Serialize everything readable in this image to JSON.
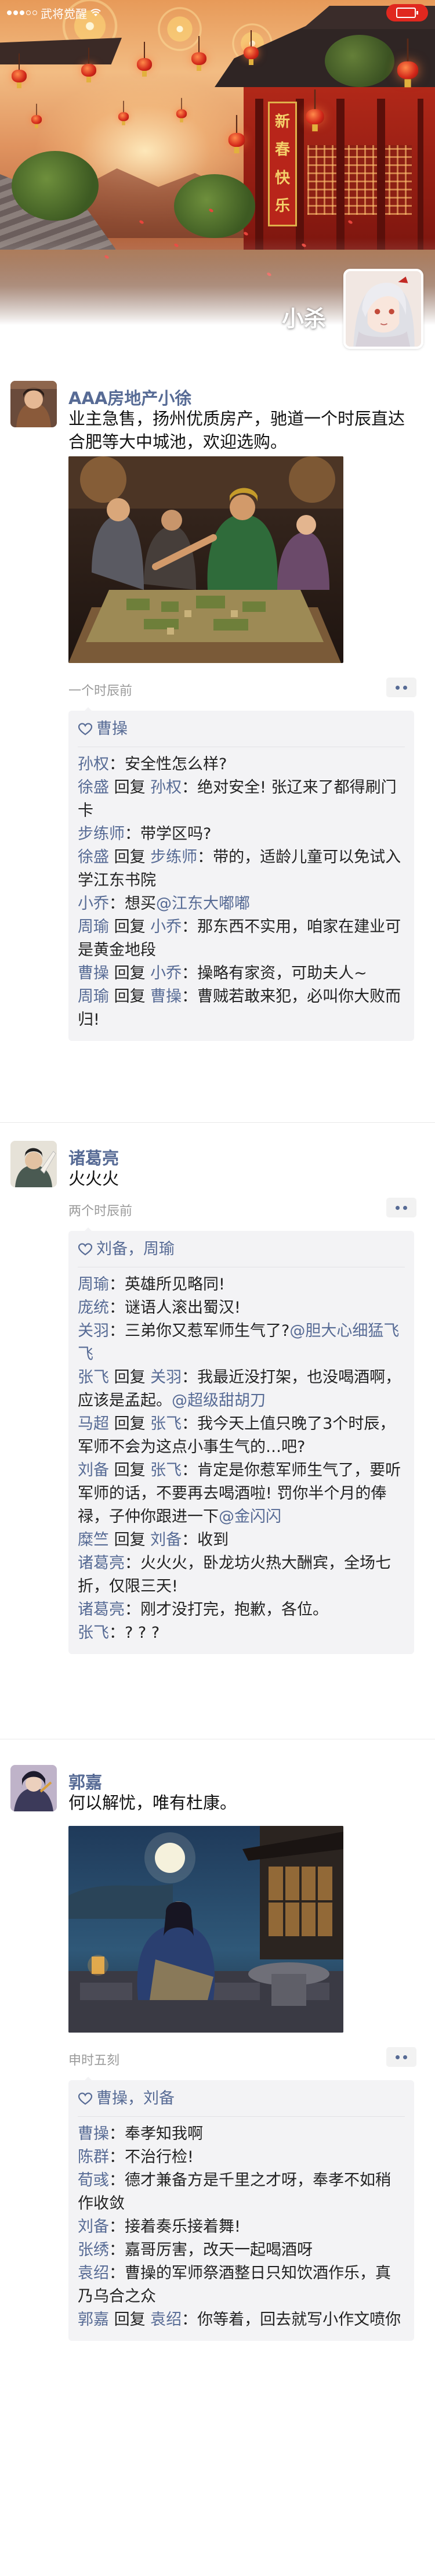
{
  "status_bar": {
    "carrier": "武将觉醒",
    "signal_bars": 5,
    "signal_filled": 3
  },
  "profile": {
    "nickname": "小杀"
  },
  "posts": [
    {
      "author": "AAA房地产小徐",
      "text": "业主急售，扬州优质房产，驰道一个时辰直达合肥等大中城池，欢迎选购。",
      "time": "一个时辰前",
      "likes": "曹操",
      "comments": [
        {
          "from": "孙权",
          "to": "",
          "text": "：安全性怎么样?"
        },
        {
          "from": "徐盛",
          "to": "孙权",
          "text": "：绝对安全! 张辽来了都得刷门卡"
        },
        {
          "from": "步练师",
          "to": "",
          "text": "：带学区吗?"
        },
        {
          "from": "徐盛",
          "to": "步练师",
          "text": "：带的，适龄儿童可以免试入学江东书院"
        },
        {
          "from": "小乔",
          "to": "",
          "text": "：想买",
          "mention": "@江东大嘟嘟"
        },
        {
          "from": "周瑜",
          "to": "小乔",
          "text": "：那东西不实用，咱家在建业可是黄金地段"
        },
        {
          "from": "曹操",
          "to": "小乔",
          "text": "：操略有家资，可助夫人~"
        },
        {
          "from": "周瑜",
          "to": "曹操",
          "text": "：曹贼若敢来犯，必叫你大败而归!"
        }
      ]
    },
    {
      "author": "诸葛亮",
      "text": "火火火",
      "time": "两个时辰前",
      "likes": "刘备，周瑜",
      "comments": [
        {
          "from": "周瑜",
          "to": "",
          "text": "：英雄所见略同!"
        },
        {
          "from": "庞统",
          "to": "",
          "text": "：谜语人滚出蜀汉!"
        },
        {
          "from": "关羽",
          "to": "",
          "text": "：三弟你又惹军师生气了?",
          "mention": "@胆大心细猛飞飞"
        },
        {
          "from": "张飞",
          "to": "关羽",
          "text": "：我最近没打架，也没喝酒啊，应该是孟起。",
          "mention": "@超级甜胡刀"
        },
        {
          "from": "马超",
          "to": "张飞",
          "text": "：我今天上值只晚了3个时辰，军师不会为这点小事生气的…吧?"
        },
        {
          "from": "刘备",
          "to": "张飞",
          "text": "：肯定是你惹军师生气了，要听军师的话，不要再去喝酒啦! 罚你半个月的俸禄，子仲你跟进一下",
          "mention": "@金闪闪"
        },
        {
          "from": "糜竺",
          "to": "刘备",
          "text": "：收到"
        },
        {
          "from": "诸葛亮",
          "to": "",
          "text": "：火火火，卧龙坊火热大酬宾，全场七折，仅限三天!"
        },
        {
          "from": "诸葛亮",
          "to": "",
          "text": "：刚才没打完，抱歉，各位。"
        },
        {
          "from": "张飞",
          "to": "",
          "text": "：? ? ?"
        }
      ]
    },
    {
      "author": "郭嘉",
      "text": "何以解忧，唯有杜康。",
      "time": "申时五刻",
      "likes": "曹操，刘备",
      "comments": [
        {
          "from": "曹操",
          "to": "",
          "text": "：奉孝知我啊"
        },
        {
          "from": "陈群",
          "to": "",
          "text": "：不治行检!"
        },
        {
          "from": "荀彧",
          "to": "",
          "text": "：德才兼备方是千里之才呀，奉孝不如稍作收敛"
        },
        {
          "from": "刘备",
          "to": "",
          "text": "：接着奏乐接着舞!"
        },
        {
          "from": "张绣",
          "to": "",
          "text": "：嘉哥厉害，改天一起喝酒呀"
        },
        {
          "from": "袁绍",
          "to": "",
          "text": "：曹操的军师祭酒整日只知饮酒作乐，真乃乌合之众"
        },
        {
          "from": "郭嘉",
          "to": "袁绍",
          "text": "：你等着，回去就写小作文喷你"
        }
      ]
    }
  ],
  "ui": {
    "reply_word": "回复"
  },
  "colors": {
    "link": "#576b95",
    "comment_bg": "#f3f3f5",
    "battery": "#e0281f"
  }
}
